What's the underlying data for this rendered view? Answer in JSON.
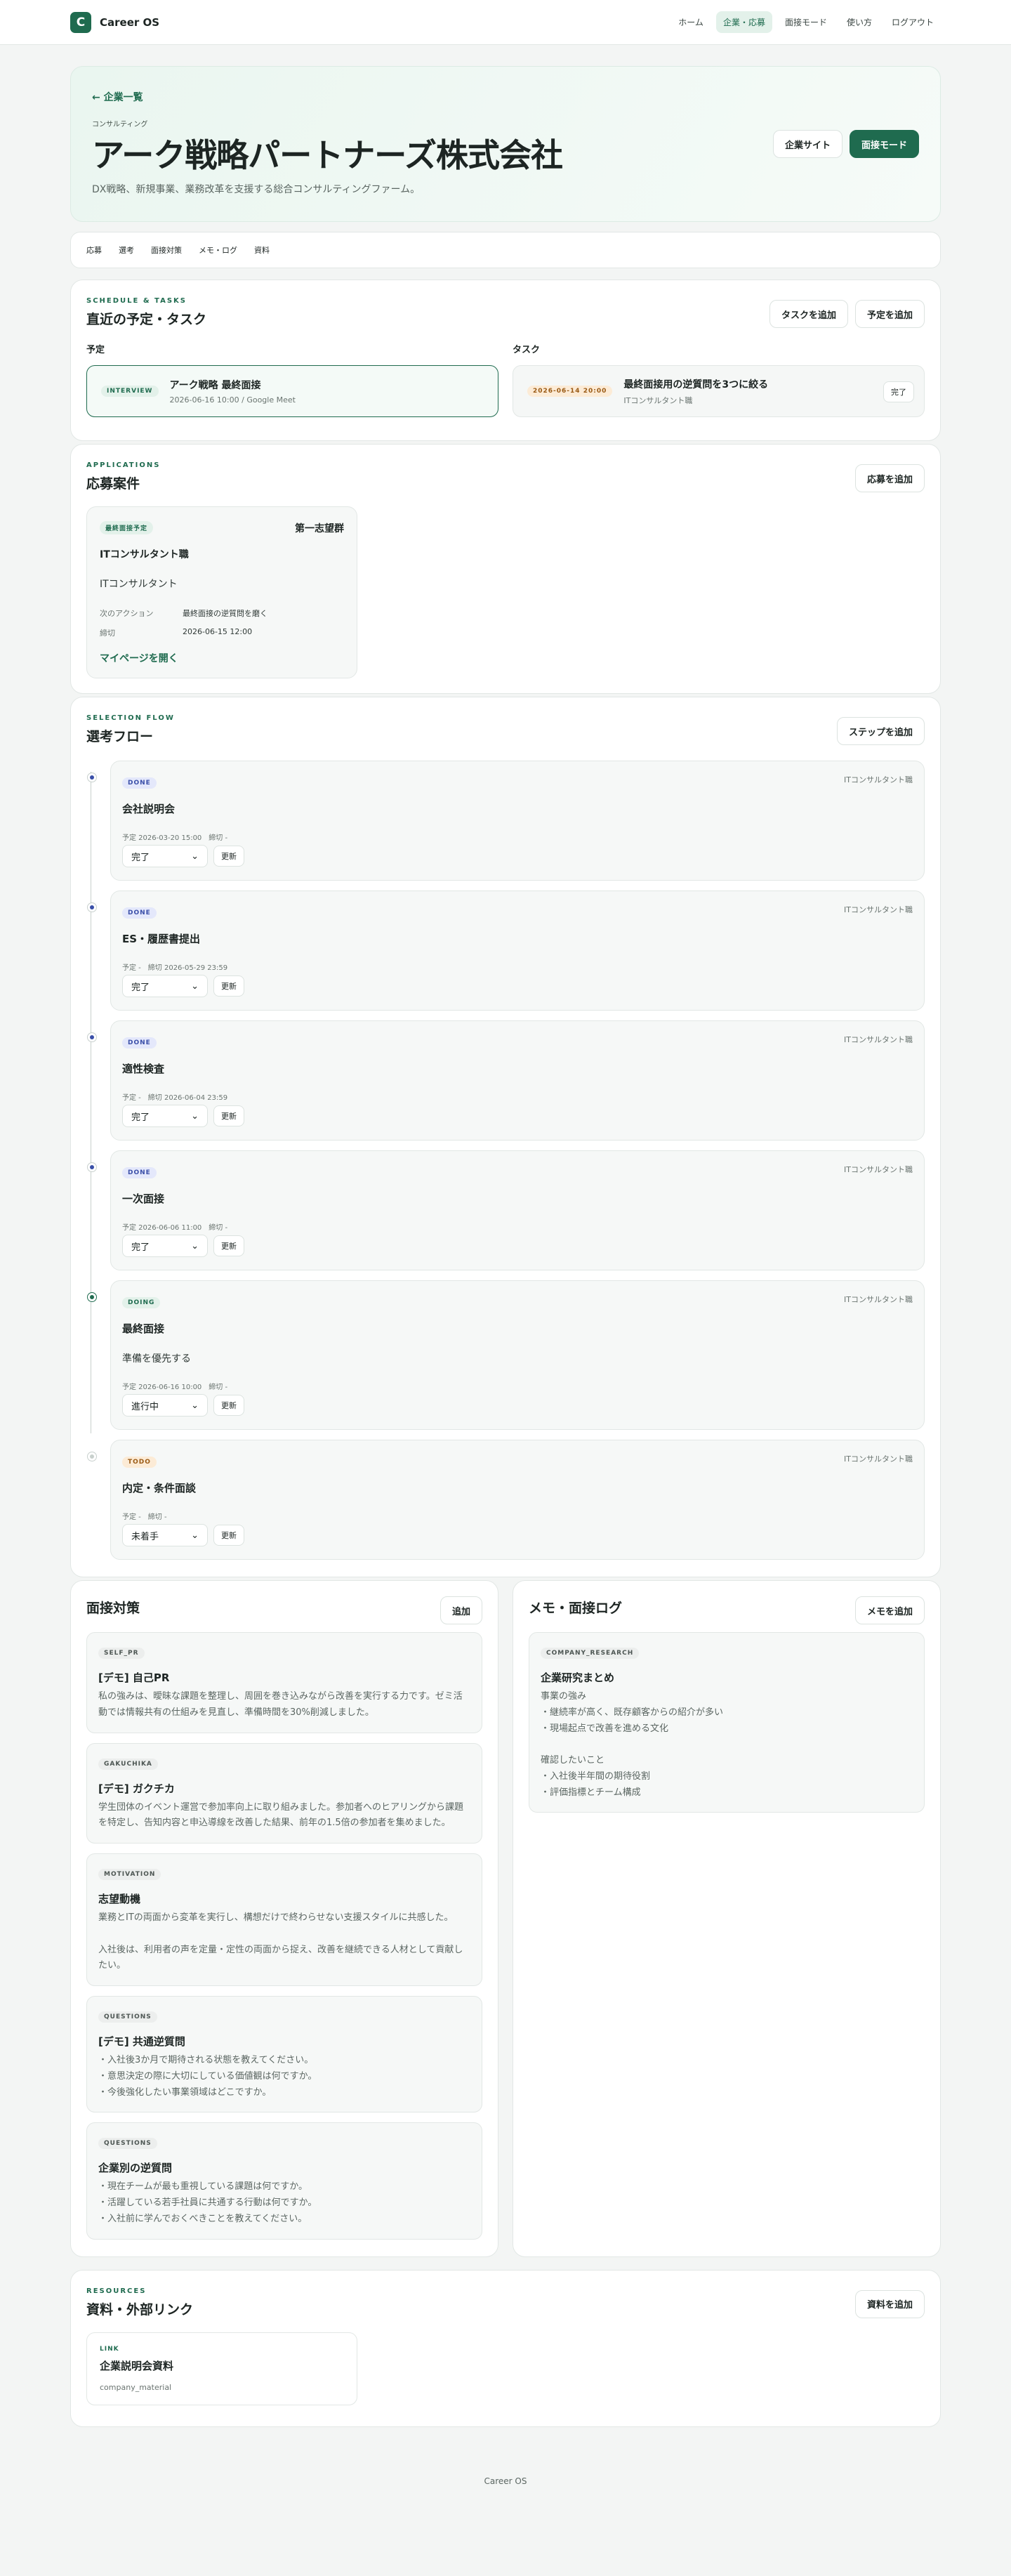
{
  "brand": {
    "logo_letter": "C",
    "name": "Career OS"
  },
  "nav": [
    "ホーム",
    "企業・応募",
    "面接モード",
    "使い方",
    "ログアウト"
  ],
  "hero": {
    "back": "← 企業一覧",
    "category": "コンサルティング",
    "title": "アーク戦略パートナーズ株式会社",
    "description": "DX戦略、新規事業、業務改革を支援する総合コンサルティングファーム。",
    "site_button": "企業サイト",
    "interview_button": "面接モード"
  },
  "tabs": [
    "応募",
    "選考",
    "面接対策",
    "メモ・ログ",
    "資料"
  ],
  "schedule": {
    "eyebrow": "SCHEDULE & TASKS",
    "title": "直近の予定・タスク",
    "add_task": "タスクを追加",
    "add_event": "予定を追加",
    "events_label": "予定",
    "tasks_label": "タスク",
    "event": {
      "badge": "INTERVIEW",
      "title": "アーク戦略 最終面接",
      "sub": "2026-06-16 10:00 / Google Meet"
    },
    "task": {
      "badge": "2026-06-14 20:00",
      "title": "最終面接用の逆質問を3つに絞る",
      "sub": "ITコンサルタント職",
      "done": "完了"
    }
  },
  "applications": {
    "eyebrow": "APPLICATIONS",
    "title": "応募案件",
    "add": "応募を追加",
    "item": {
      "status": "最終面接予定",
      "priority": "第一志望群",
      "role": "ITコンサルタント職",
      "category": "ITコンサルタント",
      "next_action_label": "次のアクション",
      "next_action": "最終面接の逆質問を磨く",
      "deadline_label": "締切",
      "deadline": "2026-06-15 12:00",
      "link": "マイページを開く"
    }
  },
  "flow": {
    "eyebrow": "SELECTION FLOW",
    "title": "選考フロー",
    "add": "ステップを追加",
    "update": "更新",
    "steps": [
      {
        "status": "DONE",
        "meta": "ITコンサルタント職",
        "title": "会社説明会",
        "dates": "予定 2026-03-20 15:00　締切 -",
        "select": "完了"
      },
      {
        "status": "DONE",
        "meta": "ITコンサルタント職",
        "title": "ES・履歴書提出",
        "dates": "予定 -　締切 2026-05-29 23:59",
        "select": "完了"
      },
      {
        "status": "DONE",
        "meta": "ITコンサルタント職",
        "title": "適性検査",
        "dates": "予定 -　締切 2026-06-04 23:59",
        "select": "完了"
      },
      {
        "status": "DONE",
        "meta": "ITコンサルタント職",
        "title": "一次面接",
        "dates": "予定 2026-06-06 11:00　締切 -",
        "select": "完了"
      },
      {
        "status": "DOING",
        "meta": "ITコンサルタント職",
        "title": "最終面接",
        "note": "準備を優先する",
        "dates": "予定 2026-06-16 10:00　締切 -",
        "select": "進行中"
      },
      {
        "status": "TODO",
        "meta": "ITコンサルタント職",
        "title": "内定・条件面談",
        "dates": "予定 -　締切 -",
        "select": "未着手"
      }
    ]
  },
  "prep": {
    "title": "面接対策",
    "add": "追加",
    "items": [
      {
        "tag": "SELF_PR",
        "title": "[デモ] 自己PR",
        "body": "私の強みは、曖昧な課題を整理し、周囲を巻き込みながら改善を実行する力です。ゼミ活動では情報共有の仕組みを見直し、準備時間を30%削減しました。"
      },
      {
        "tag": "GAKUCHIKA",
        "title": "[デモ] ガクチカ",
        "body": "学生団体のイベント運営で参加率向上に取り組みました。参加者へのヒアリングから課題を特定し、告知内容と申込導線を改善した結果、前年の1.5倍の参加者を集めました。"
      },
      {
        "tag": "MOTIVATION",
        "title": "志望動機",
        "body": "業務とITの両面から変革を実行し、構想だけで終わらせない支援スタイルに共感した。\n\n入社後は、利用者の声を定量・定性の両面から捉え、改善を継続できる人材として貢献したい。"
      },
      {
        "tag": "QUESTIONS",
        "title": "[デモ] 共通逆質問",
        "body": "・入社後3か月で期待される状態を教えてください。\n・意思決定の際に大切にしている価値観は何ですか。\n・今後強化したい事業領域はどこですか。"
      },
      {
        "tag": "QUESTIONS",
        "title": "企業別の逆質問",
        "body": "・現在チームが最も重視している課題は何ですか。\n・活躍している若手社員に共通する行動は何ですか。\n・入社前に学んでおくべきことを教えてください。"
      }
    ]
  },
  "memo": {
    "title": "メモ・面接ログ",
    "add": "メモを追加",
    "item": {
      "tag": "COMPANY_RESEARCH",
      "title": "企業研究まとめ",
      "body": "事業の強み\n・継続率が高く、既存顧客からの紹介が多い\n・現場起点で改善を進める文化\n\n確認したいこと\n・入社後半年間の期待役割\n・評価指標とチーム構成"
    }
  },
  "resources": {
    "eyebrow": "RESOURCES",
    "title": "資料・外部リンク",
    "add": "資料を追加",
    "item": {
      "tag": "LINK",
      "title": "企業説明会資料",
      "sub": "company_material"
    }
  },
  "footer": "Career OS"
}
